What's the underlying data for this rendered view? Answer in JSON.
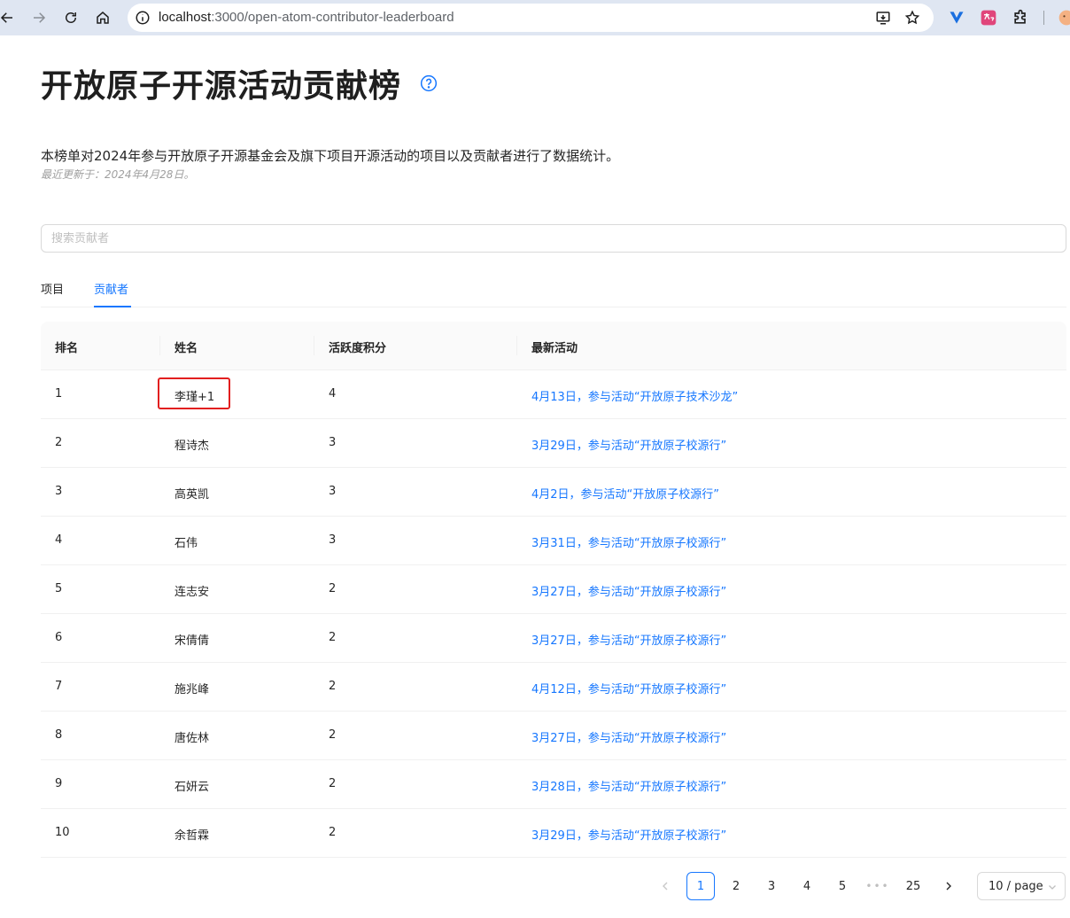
{
  "browser": {
    "url_host": "localhost",
    "url_path": ":3000/open-atom-contributor-leaderboard"
  },
  "page": {
    "title": "开放原子开源活动贡献榜",
    "description": "本榜单对2024年参与开放原子开源基金会及旗下项目开源活动的项目以及贡献者进行了数据统计。",
    "updated": "最近更新于：2024年4月28日。"
  },
  "search": {
    "placeholder": "搜索贡献者"
  },
  "tabs": [
    {
      "label": "项目",
      "active": false
    },
    {
      "label": "贡献者",
      "active": true
    }
  ],
  "table": {
    "headers": [
      "排名",
      "姓名",
      "活跃度积分",
      "最新活动"
    ],
    "rows": [
      {
        "rank": "1",
        "name": "李瑾+1",
        "score": "4",
        "activity": "4月13日，参与活动“开放原子技术沙龙”"
      },
      {
        "rank": "2",
        "name": "程诗杰",
        "score": "3",
        "activity": "3月29日，参与活动“开放原子校源行”"
      },
      {
        "rank": "3",
        "name": "高英凯",
        "score": "3",
        "activity": "4月2日，参与活动“开放原子校源行”"
      },
      {
        "rank": "4",
        "name": "石伟",
        "score": "3",
        "activity": "3月31日，参与活动“开放原子校源行”"
      },
      {
        "rank": "5",
        "name": "连志安",
        "score": "2",
        "activity": "3月27日，参与活动“开放原子校源行”"
      },
      {
        "rank": "6",
        "name": "宋倩倩",
        "score": "2",
        "activity": "3月27日，参与活动“开放原子校源行”"
      },
      {
        "rank": "7",
        "name": "施兆峰",
        "score": "2",
        "activity": "4月12日，参与活动“开放原子校源行”"
      },
      {
        "rank": "8",
        "name": "唐佐林",
        "score": "2",
        "activity": "3月27日，参与活动“开放原子校源行”"
      },
      {
        "rank": "9",
        "name": "石妍云",
        "score": "2",
        "activity": "3月28日，参与活动“开放原子校源行”"
      },
      {
        "rank": "10",
        "name": "余哲霖",
        "score": "2",
        "activity": "3月29日，参与活动“开放原子校源行”"
      }
    ]
  },
  "pagination": {
    "pages": [
      "1",
      "2",
      "3",
      "4",
      "5"
    ],
    "ellipsis": "•••",
    "last_page": "25",
    "current": "1",
    "page_size": "10 / page"
  },
  "colors": {
    "accent": "#1677ff",
    "highlight_box": "#e21f1f"
  }
}
